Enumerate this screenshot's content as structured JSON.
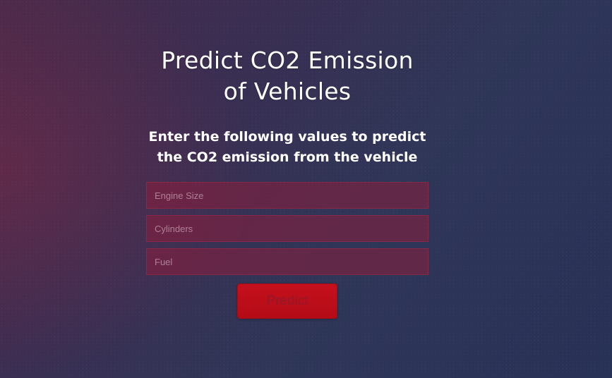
{
  "page": {
    "title": "Predict CO2 Emission of Vehicles",
    "subtitle": "Enter the following values to predict the CO2 emission from the vehicle"
  },
  "form": {
    "fields": [
      {
        "name": "engine_size",
        "placeholder": "Engine Size",
        "value": ""
      },
      {
        "name": "cylinders",
        "placeholder": "Cylinders",
        "value": ""
      },
      {
        "name": "fuel",
        "placeholder": "Fuel",
        "value": ""
      }
    ],
    "submit_label": "Predict"
  },
  "colors": {
    "background_start": "#4a2a4a",
    "background_end": "#283156",
    "field_background": "#7a2a45",
    "button": "#c5101c",
    "text": "#ffffff"
  }
}
